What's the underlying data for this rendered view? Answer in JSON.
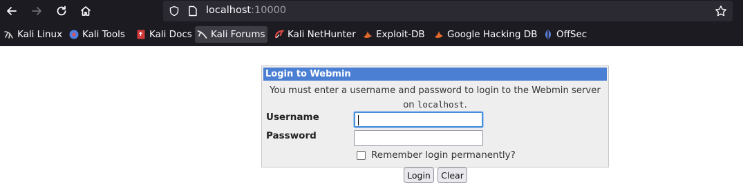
{
  "browser": {
    "url_host": "localhost",
    "url_port": ":10000",
    "bookmarks": [
      {
        "label": "Kali Linux",
        "icon": "kali-dragon-icon"
      },
      {
        "label": "Kali Tools",
        "icon": "kali-tools-icon"
      },
      {
        "label": "Kali Docs",
        "icon": "kali-docs-icon"
      },
      {
        "label": "Kali Forums",
        "icon": "kali-forums-icon",
        "active": true
      },
      {
        "label": "Kali NetHunter",
        "icon": "nethunter-icon"
      },
      {
        "label": "Exploit-DB",
        "icon": "exploit-db-icon"
      },
      {
        "label": "Google Hacking DB",
        "icon": "ghdb-icon"
      },
      {
        "label": "OffSec",
        "icon": "offsec-icon"
      }
    ]
  },
  "login": {
    "title": "Login to Webmin",
    "message_line1": "You must enter a username and password to login to the Webmin server",
    "message_on": "on ",
    "message_host": "localhost",
    "message_end": ".",
    "username_label": "Username",
    "password_label": "Password",
    "username_value": "",
    "password_value": "",
    "remember_label": "Remember login permanently?",
    "remember_checked": false,
    "login_button": "Login",
    "clear_button": "Clear"
  },
  "colors": {
    "title_bar": "#4a7fd4",
    "chrome_bg": "#1c1b22",
    "urlbar_bg": "#2b2a33"
  }
}
